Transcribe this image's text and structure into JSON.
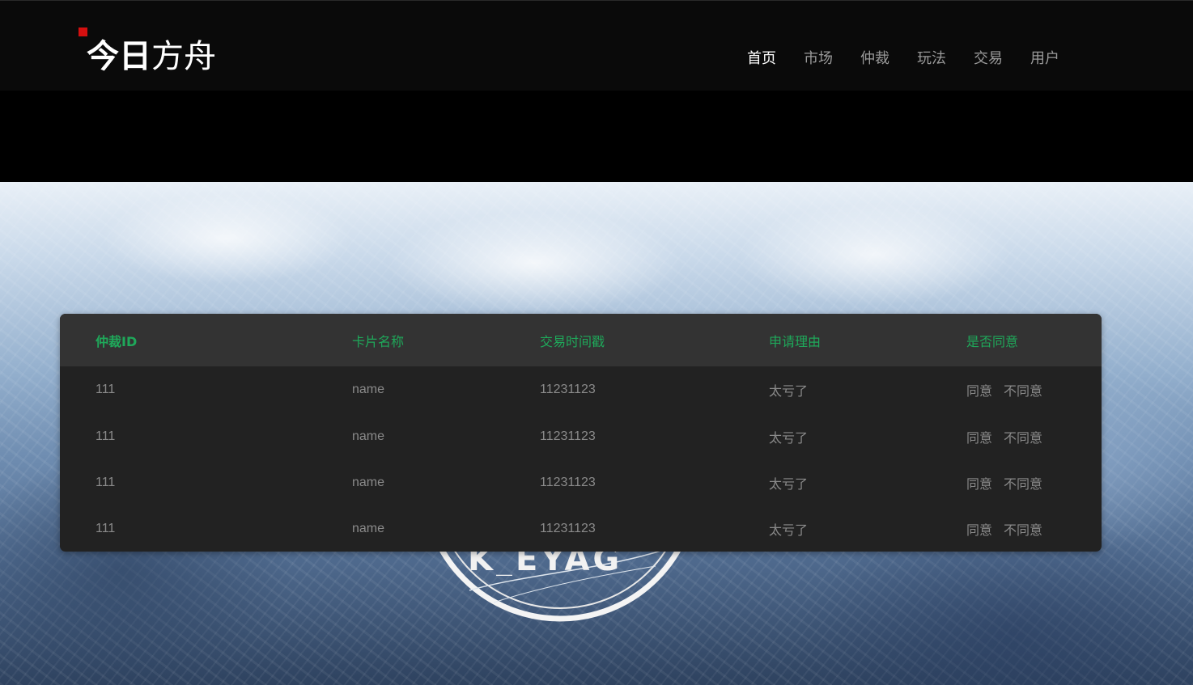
{
  "logo": {
    "bold_text": "今日",
    "light_text": "方舟"
  },
  "nav": {
    "items": [
      {
        "label": "首页",
        "active": true
      },
      {
        "label": "市场",
        "active": false
      },
      {
        "label": "仲裁",
        "active": false
      },
      {
        "label": "玩法",
        "active": false
      },
      {
        "label": "交易",
        "active": false
      },
      {
        "label": "用户",
        "active": false
      }
    ]
  },
  "emblem": {
    "text": "K_EYAG"
  },
  "table": {
    "headers": [
      "仲裁ID",
      "卡片名称",
      "交易时间戳",
      "申请理由",
      "是否同意"
    ],
    "rows": [
      {
        "id": "111",
        "name": "name",
        "timestamp": "11231123",
        "reason": "太亏了",
        "agree": "同意",
        "disagree": "不同意"
      },
      {
        "id": "111",
        "name": "name",
        "timestamp": "11231123",
        "reason": "太亏了",
        "agree": "同意",
        "disagree": "不同意"
      },
      {
        "id": "111",
        "name": "name",
        "timestamp": "11231123",
        "reason": "太亏了",
        "agree": "同意",
        "disagree": "不同意"
      },
      {
        "id": "111",
        "name": "name",
        "timestamp": "11231123",
        "reason": "太亏了",
        "agree": "同意",
        "disagree": "不同意"
      }
    ]
  },
  "colors": {
    "header_text": "#1fa85a",
    "cell_text": "#8a8a8a",
    "logo_mark": "#d40f0f",
    "panel_bg": "#222222",
    "thead_bg": "#333333"
  }
}
